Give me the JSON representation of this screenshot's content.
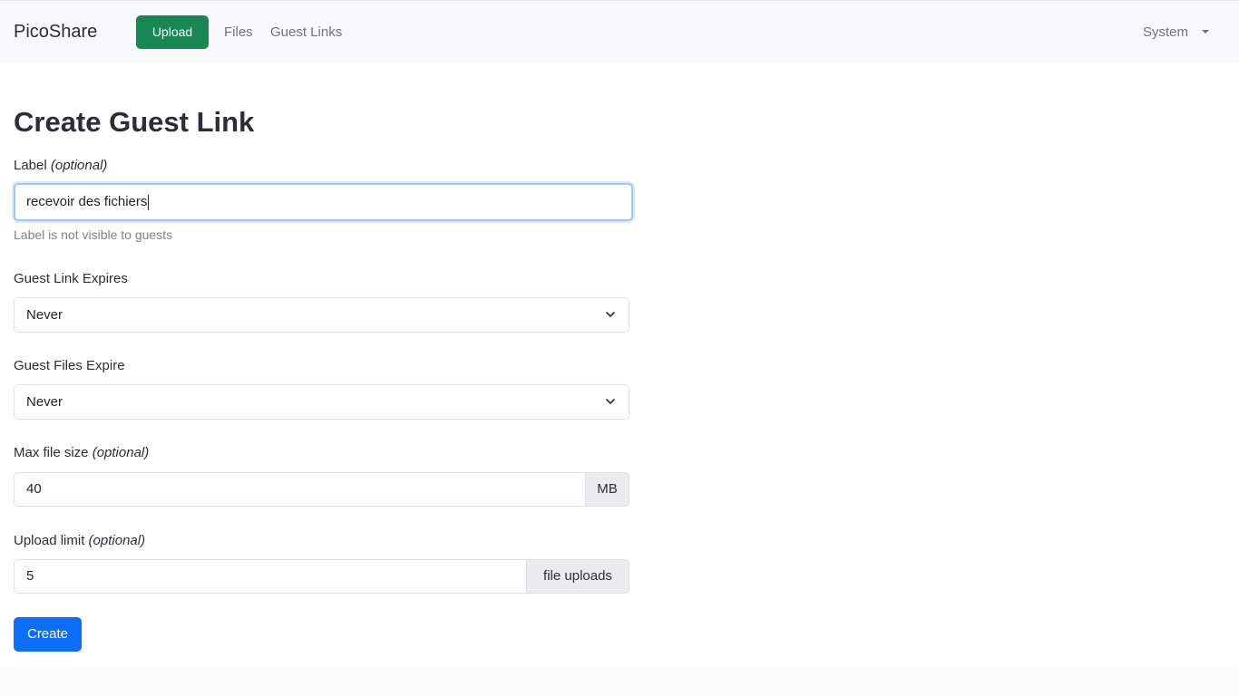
{
  "navbar": {
    "brand": "PicoShare",
    "upload_label": "Upload",
    "files_label": "Files",
    "guest_links_label": "Guest Links",
    "system_label": "System"
  },
  "page": {
    "title": "Create Guest Link"
  },
  "form": {
    "label_field": {
      "label": "Label",
      "optional": "(optional)",
      "value": "recevoir des fichiers",
      "help": "Label is not visible to guests"
    },
    "link_expires": {
      "label": "Guest Link Expires",
      "selected": "Never"
    },
    "files_expire": {
      "label": "Guest Files Expire",
      "selected": "Never"
    },
    "max_file_size": {
      "label": "Max file size",
      "optional": "(optional)",
      "value": "40",
      "unit": "MB"
    },
    "upload_limit": {
      "label": "Upload limit",
      "optional": "(optional)",
      "value": "5",
      "unit": "file uploads"
    },
    "create_label": "Create"
  },
  "icons": {
    "select_arrow": "chevron-down-icon",
    "system_caret": "caret-down-icon"
  },
  "colors": {
    "upload_button": "#198754",
    "create_button": "#0d6efd",
    "focus_border": "#9ec5fe"
  }
}
